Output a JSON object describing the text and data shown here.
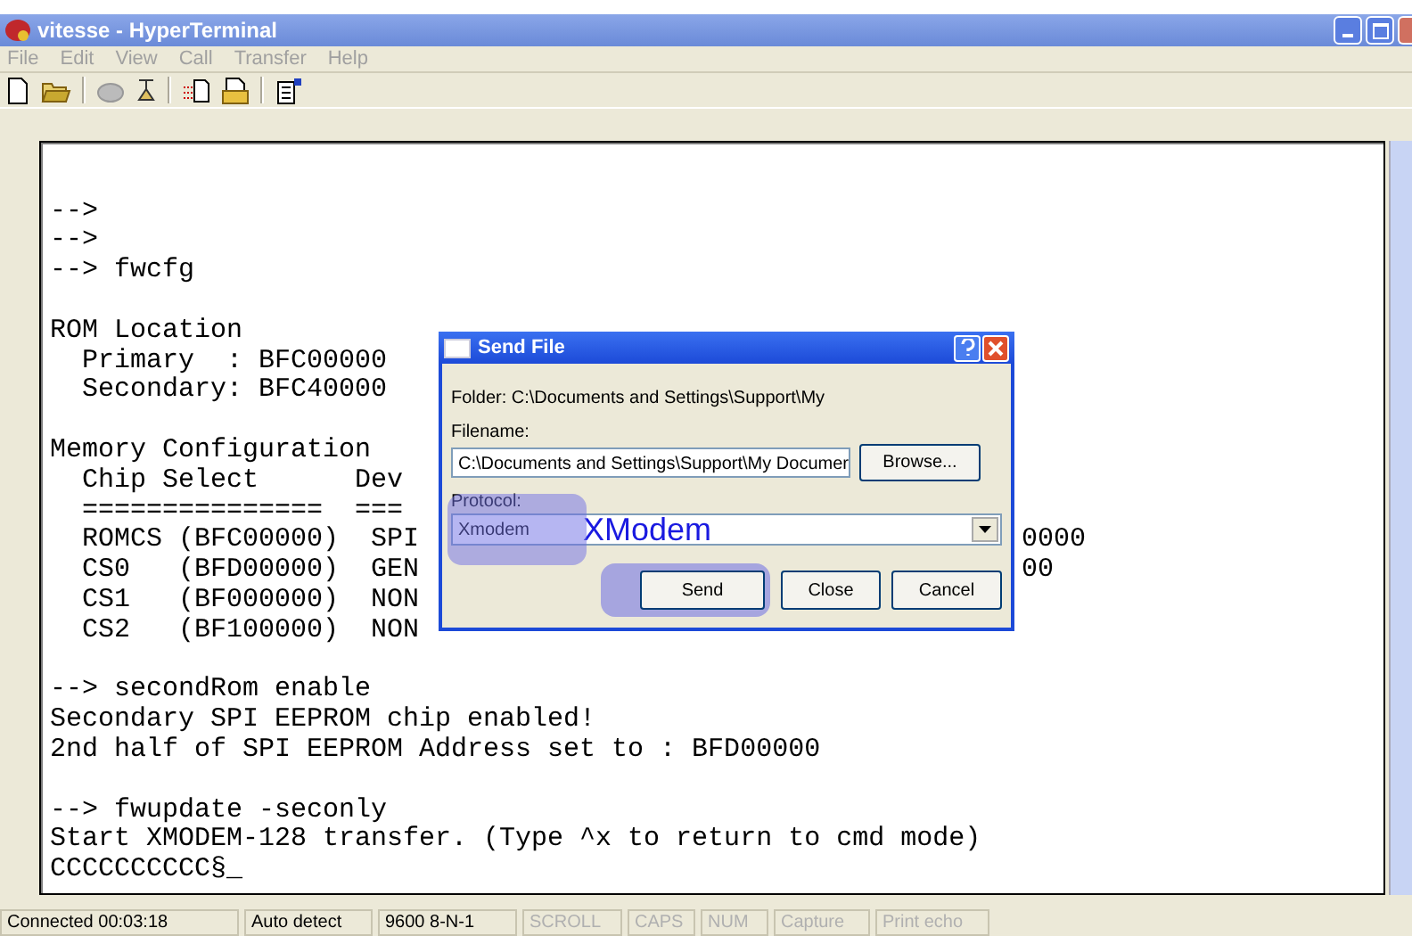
{
  "window": {
    "title": "vitesse - HyperTerminal"
  },
  "menu": [
    {
      "label": "File"
    },
    {
      "label": "Edit"
    },
    {
      "label": "View"
    },
    {
      "label": "Call"
    },
    {
      "label": "Transfer"
    },
    {
      "label": "Help"
    }
  ],
  "terminal": {
    "blocks": [
      {
        "lines": [
          {
            "text": "-->"
          },
          {
            "text": "-->"
          },
          {
            "text": "--> fwcfg"
          }
        ]
      },
      {
        "lines": [
          {
            "text": "ROM Location"
          },
          {
            "text": "  Primary  : BFC00000"
          },
          {
            "text": "  Secondary: BFC40000"
          }
        ]
      },
      {
        "lines": [
          {
            "text": "Memory Configuration"
          },
          {
            "text": "  Chip Select      Dev"
          },
          {
            "text": "  ===============  ==="
          },
          {
            "text": "  ROMCS (BFC00000)  SPI",
            "tail": "0000"
          },
          {
            "text": "  CS0   (BFD00000)  GEN",
            "tail": "00"
          },
          {
            "text": "  CS1   (BF000000)  NON"
          },
          {
            "text": "  CS2   (BF100000)  NON"
          }
        ]
      },
      {
        "lines": [
          {
            "text": "--> secondRom enable"
          },
          {
            "text": "Secondary SPI EEPROM chip enabled!"
          },
          {
            "text": "2nd half of SPI EEPROM Address set to : BFD00000"
          }
        ]
      },
      {
        "lines": [
          {
            "text": "--> fwupdate -seconly"
          },
          {
            "text": "Start XMODEM-128 transfer. (Type ^x to return to cmd mode)"
          },
          {
            "text": "CCCCCCCCCC§_"
          }
        ]
      }
    ]
  },
  "dialog": {
    "title": "Send File",
    "folder": "Folder:  C:\\Documents and Settings\\Support\\My",
    "filename_label": "Filename:",
    "filename": "C:\\Documents and Settings\\Support\\My Documer",
    "browse": "Browse...",
    "protocol_label": "Protocol:",
    "protocol": "Xmodem",
    "protocol_highlighted": true,
    "buttons": [
      {
        "label": "Send",
        "highlighted": true
      },
      {
        "label": "Close",
        "highlighted": false
      },
      {
        "label": "Cancel",
        "highlighted": false
      }
    ]
  },
  "annotation": {
    "text": "XModem"
  },
  "status_bar": [
    {
      "text": "Connected 00:03:18",
      "disabled": false
    },
    {
      "text": "Auto detect",
      "disabled": false
    },
    {
      "text": "9600 8-N-1",
      "disabled": false
    },
    {
      "text": "SCROLL",
      "disabled": true
    },
    {
      "text": "CAPS",
      "disabled": true
    },
    {
      "text": "NUM",
      "disabled": true
    },
    {
      "text": "Capture",
      "disabled": true
    },
    {
      "text": "Print echo",
      "disabled": true
    }
  ]
}
